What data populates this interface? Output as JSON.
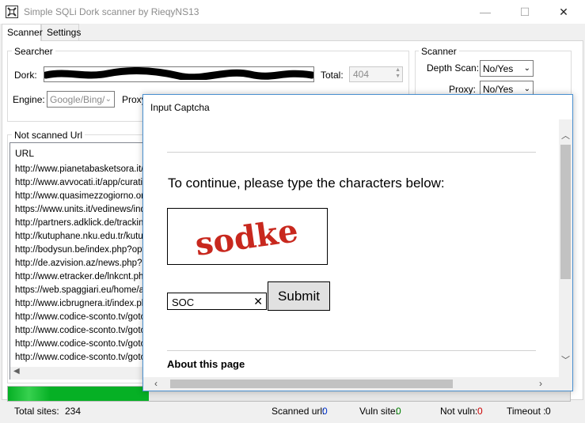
{
  "window": {
    "title": "Simple SQLi Dork scanner by RieqyNS13",
    "minimize_glyph": "—",
    "maximize_glyph": "☐",
    "close_glyph": "✕"
  },
  "tabs": [
    "Scanner",
    "Settings"
  ],
  "searcher": {
    "title": "Searcher",
    "dork_label": "Dork:",
    "total_label": "Total:",
    "total_value": "404",
    "engine_label": "Engine:",
    "engine_value": "Google/Bing/",
    "proxy_label": "Proxy"
  },
  "scanner_group": {
    "title": "Scanner",
    "depth_label": "Depth Scan:",
    "depth_value": "No/Yes",
    "proxy_label": "Proxy:",
    "proxy_value": "No/Yes"
  },
  "not_scanned": {
    "title": "Not scanned Url",
    "column_header": "URL",
    "urls": [
      "http://www.pianetabasketsora.it/i",
      "http://www.avvocati.it/app/curati",
      "http://www.quasimezzogiorno.org",
      "https://www.units.it/vedinews/ind",
      "http://partners.adklick.de/tracking",
      "http://kutuphane.nku.edu.tr/kutup",
      "http://bodysun.be/index.php?opti",
      "http://de.azvision.az/news.php?i",
      "http://www.etracker.de/lnkcnt.ph",
      "https://web.spaggiari.eu/home/ap",
      "http://www.icbrugnera.it/index.ph",
      "http://www.codice-sconto.tv/gotc",
      "http://www.codice-sconto.tv/gotc",
      "http://www.codice-sconto.tv/gotc",
      "http://www.codice-sconto.tv/gotc"
    ]
  },
  "progress": {
    "fraction": 0.25
  },
  "status": {
    "total_sites_label": "Total sites:",
    "total_sites_value": "234",
    "scanned_label": "Scanned url:",
    "scanned_value": "0",
    "vuln_label": "Vuln site:",
    "vuln_value": "0",
    "notvuln_label": "Not vuln:",
    "notvuln_value": "0",
    "timeout_label": "Timeout :",
    "timeout_value": "0"
  },
  "captcha_dialog": {
    "title": "Input Captcha",
    "prompt": "To continue, please type the characters below:",
    "captcha_text": "sodke",
    "input_value": "SOC",
    "clear_glyph": "✕",
    "submit_label": "Submit",
    "about_heading": "About this page"
  },
  "colors": {
    "progress_green": "#06b025",
    "captcha_red": "#c8281e",
    "dialog_border": "#4a90d0",
    "status_value_blue": "#0033cc",
    "status_value_green": "#008000",
    "status_value_red": "#cc0000"
  }
}
